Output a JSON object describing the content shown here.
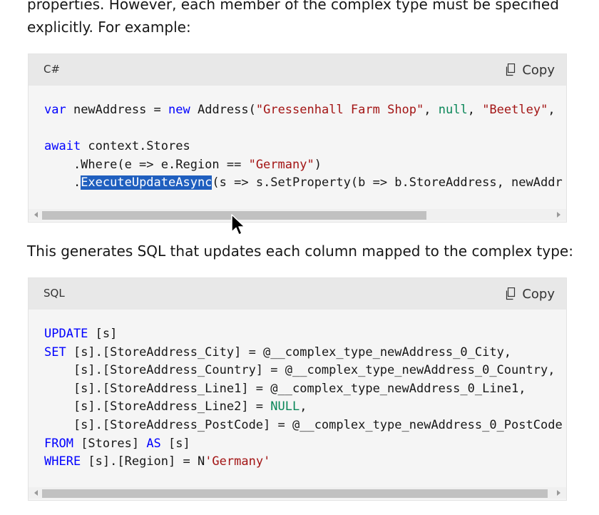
{
  "intro": {
    "line1": "properties. However, each member of the complex type must be specified",
    "line2": "explicitly. For example:"
  },
  "csharp_block": {
    "language": "C#",
    "copy_label": "Copy",
    "copy_icon": "copy-icon",
    "code": {
      "l1_kw1": "var",
      "l1_t1": " newAddress = ",
      "l1_kw2": "new",
      "l1_t2": " Address(",
      "l1_s1": "\"Gressenhall Farm Shop\"",
      "l1_t3": ", ",
      "l1_null": "null",
      "l1_t4": ", ",
      "l1_s2": "\"Beetley\"",
      "l1_t5": ",",
      "l2_kw": "await",
      "l2_t": " context.Stores",
      "l3_t": "    .Where(e => e.Region == ",
      "l3_s": "\"Germany\"",
      "l3_t2": ")",
      "l4_t1": "    .",
      "l4_sel": "ExecuteUpdateAsync",
      "l4_t2": "(s => s.SetProperty(b => b.StoreAddress, newAddr"
    },
    "scroll_fraction": 0.73
  },
  "middle_text": "This generates SQL that updates each column mapped to the complex type:",
  "sql_block": {
    "language": "SQL",
    "copy_label": "Copy",
    "copy_icon": "copy-icon",
    "code": {
      "l1_kw": "UPDATE",
      "l1_t": " [s]",
      "l2_kw": "SET",
      "l2_t": " [s].[StoreAddress_City] = @__complex_type_newAddress_0_City,",
      "l3_t": "    [s].[StoreAddress_Country] = @__complex_type_newAddress_0_Country,",
      "l4_t": "    [s].[StoreAddress_Line1] = @__complex_type_newAddress_0_Line1,",
      "l5_t": "    [s].[StoreAddress_Line2] = ",
      "l5_null": "NULL",
      "l5_t2": ",",
      "l6_t": "    [s].[StoreAddress_PostCode] = @__complex_type_newAddress_0_PostCode",
      "l7_kw1": "FROM",
      "l7_t1": " [Stores] ",
      "l7_kw2": "AS",
      "l7_t2": " [s]",
      "l8_kw": "WHERE",
      "l8_t": " [s].[Region] = N",
      "l8_s": "'Germany'"
    },
    "scroll_fraction": 0.98
  },
  "pointer": "mouse-pointer"
}
